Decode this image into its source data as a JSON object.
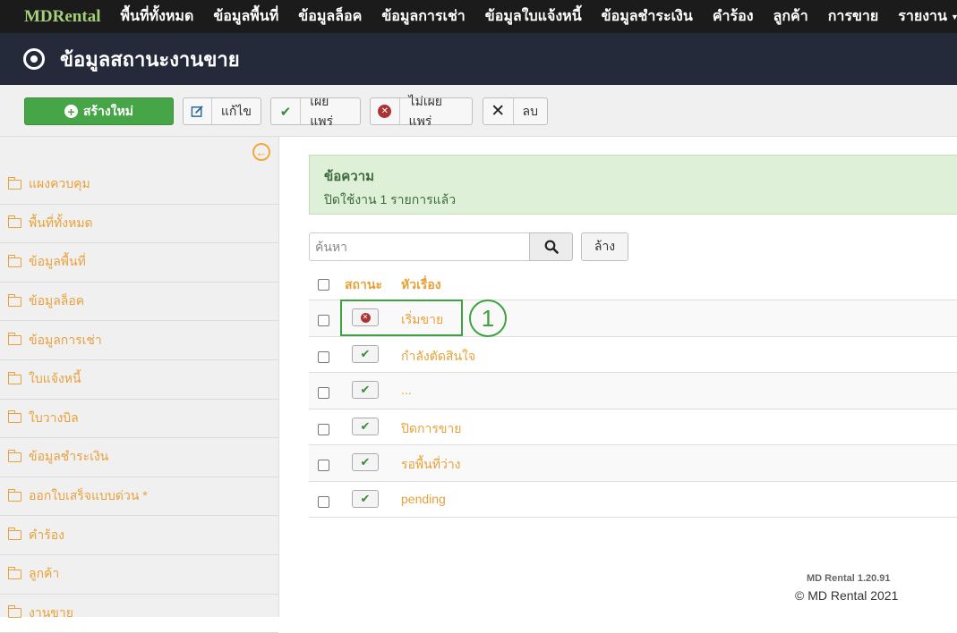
{
  "nav": {
    "brand": "MDRental",
    "items": [
      "พื้นที่ทั้งหมด",
      "ข้อมูลพื้นที่",
      "ข้อมูลล็อค",
      "ข้อมูลการเช่า",
      "ข้อมูลใบแจ้งหนี้",
      "ข้อมูลชำระเงิน",
      "คำร้อง",
      "ลูกค้า",
      "การขาย",
      "รายงาน"
    ]
  },
  "header": {
    "title": "ข้อมูลสถานะงานขาย",
    "icon": "target-icon"
  },
  "toolbar": {
    "new_label": "สร้างใหม่",
    "edit_label": "แก้ไข",
    "publish_label": "เผยแพร่",
    "unpublish_label": "ไม่เผยแพร่",
    "delete_label": "ลบ"
  },
  "sidebar": {
    "items": [
      "แผงควบคุม",
      "พื้นที่ทั้งหมด",
      "ข้อมูลพื้นที่",
      "ข้อมูลล็อค",
      "ข้อมูลการเช่า",
      "ใบแจ้งหนี้",
      "ใบวางบิล",
      "ข้อมูลชำระเงิน",
      "ออกใบเสร็จแบบด่วน *",
      "คำร้อง",
      "ลูกค้า",
      "งานขาย"
    ]
  },
  "alert": {
    "heading": "ข้อความ",
    "text": "ปิดใช้งาน 1 รายการแล้ว"
  },
  "search": {
    "placeholder": "ค้นหา",
    "clear_label": "ล้าง"
  },
  "table": {
    "headers": {
      "status": "สถานะ",
      "title": "หัวเรื่อง"
    },
    "rows": [
      {
        "title": "เริ่มขาย",
        "published": false
      },
      {
        "title": "กำลังตัดสินใจ",
        "published": true
      },
      {
        "title": "...",
        "published": true
      },
      {
        "title": "ปิดการขาย",
        "published": true
      },
      {
        "title": "รอพื้นที่ว่าง",
        "published": true
      },
      {
        "title": "pending",
        "published": true
      }
    ]
  },
  "annotation": {
    "marker": "1"
  },
  "footer": {
    "version": "MD Rental 1.20.91",
    "copyright": "© MD Rental 2021"
  },
  "colors": {
    "accent": "#e8a13a",
    "success": "#46a546",
    "header_bg": "#252a3a",
    "nav_bg": "#1b1b1b"
  }
}
